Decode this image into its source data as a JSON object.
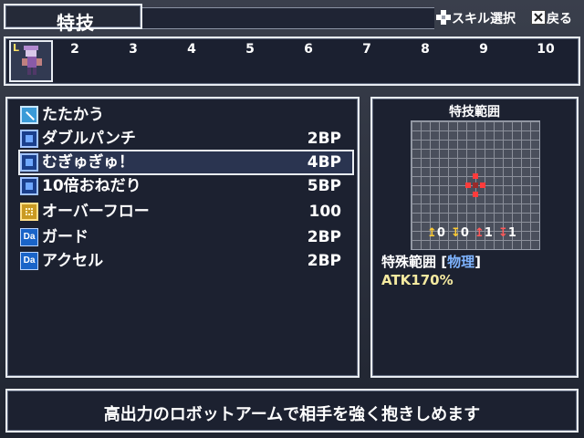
{
  "header": {
    "title": "特技",
    "hint_skill": "スキル選択",
    "hint_back": "戻る"
  },
  "turn_strip": {
    "numbers": [
      "2",
      "3",
      "4",
      "5",
      "6",
      "7",
      "8",
      "9",
      "10"
    ],
    "current_marker": "L"
  },
  "skills": [
    {
      "icon": "sword-icon",
      "name": "たたかう",
      "cost": ""
    },
    {
      "icon": "skill-icon",
      "name": "ダブルパンチ",
      "cost": "2BP"
    },
    {
      "icon": "skill-icon",
      "name": "むぎゅぎゅ！",
      "cost": "4BP",
      "selected": true
    },
    {
      "icon": "skill-icon",
      "name": "10倍おねだり",
      "cost": "5BP"
    },
    {
      "icon": "overflow-icon",
      "name": "オーバーフロー",
      "cost": "100"
    },
    {
      "icon": "da-icon",
      "name": "ガード",
      "cost": "2BP"
    },
    {
      "icon": "da-icon",
      "name": "アクセル",
      "cost": "2BP"
    }
  ],
  "range": {
    "title": "特技範囲",
    "arrows": [
      "0",
      "0",
      "1",
      "1"
    ],
    "type_label": "特殊範囲",
    "type_attr": "物理",
    "atk": "ATK170%"
  },
  "description": "高出力のロボットアームで相手を強く抱きしめます",
  "colors": {
    "panel_bg": "#1c2130",
    "border": "#e8ecf2",
    "range_red": "#ff3b3b",
    "phys_blue": "#7fb4ff",
    "atk_yellow": "#f5eaa0"
  }
}
